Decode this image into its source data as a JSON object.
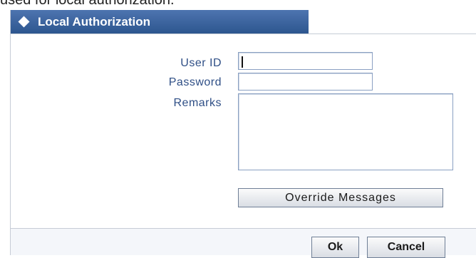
{
  "caption": "used for local authorization.",
  "dialog": {
    "title": "Local Authorization"
  },
  "form": {
    "user_id_label": "User ID",
    "user_id_value": "",
    "password_label": "Password",
    "password_value": "",
    "remarks_label": "Remarks",
    "remarks_value": ""
  },
  "buttons": {
    "override_messages": "Override Messages",
    "ok": "Ok",
    "cancel": "Cancel"
  },
  "colors": {
    "title_bar": "#3c6399",
    "label_text": "#2f4f86",
    "border": "#8aa0c2"
  },
  "icons": {
    "title_icon": "diamond-icon"
  }
}
